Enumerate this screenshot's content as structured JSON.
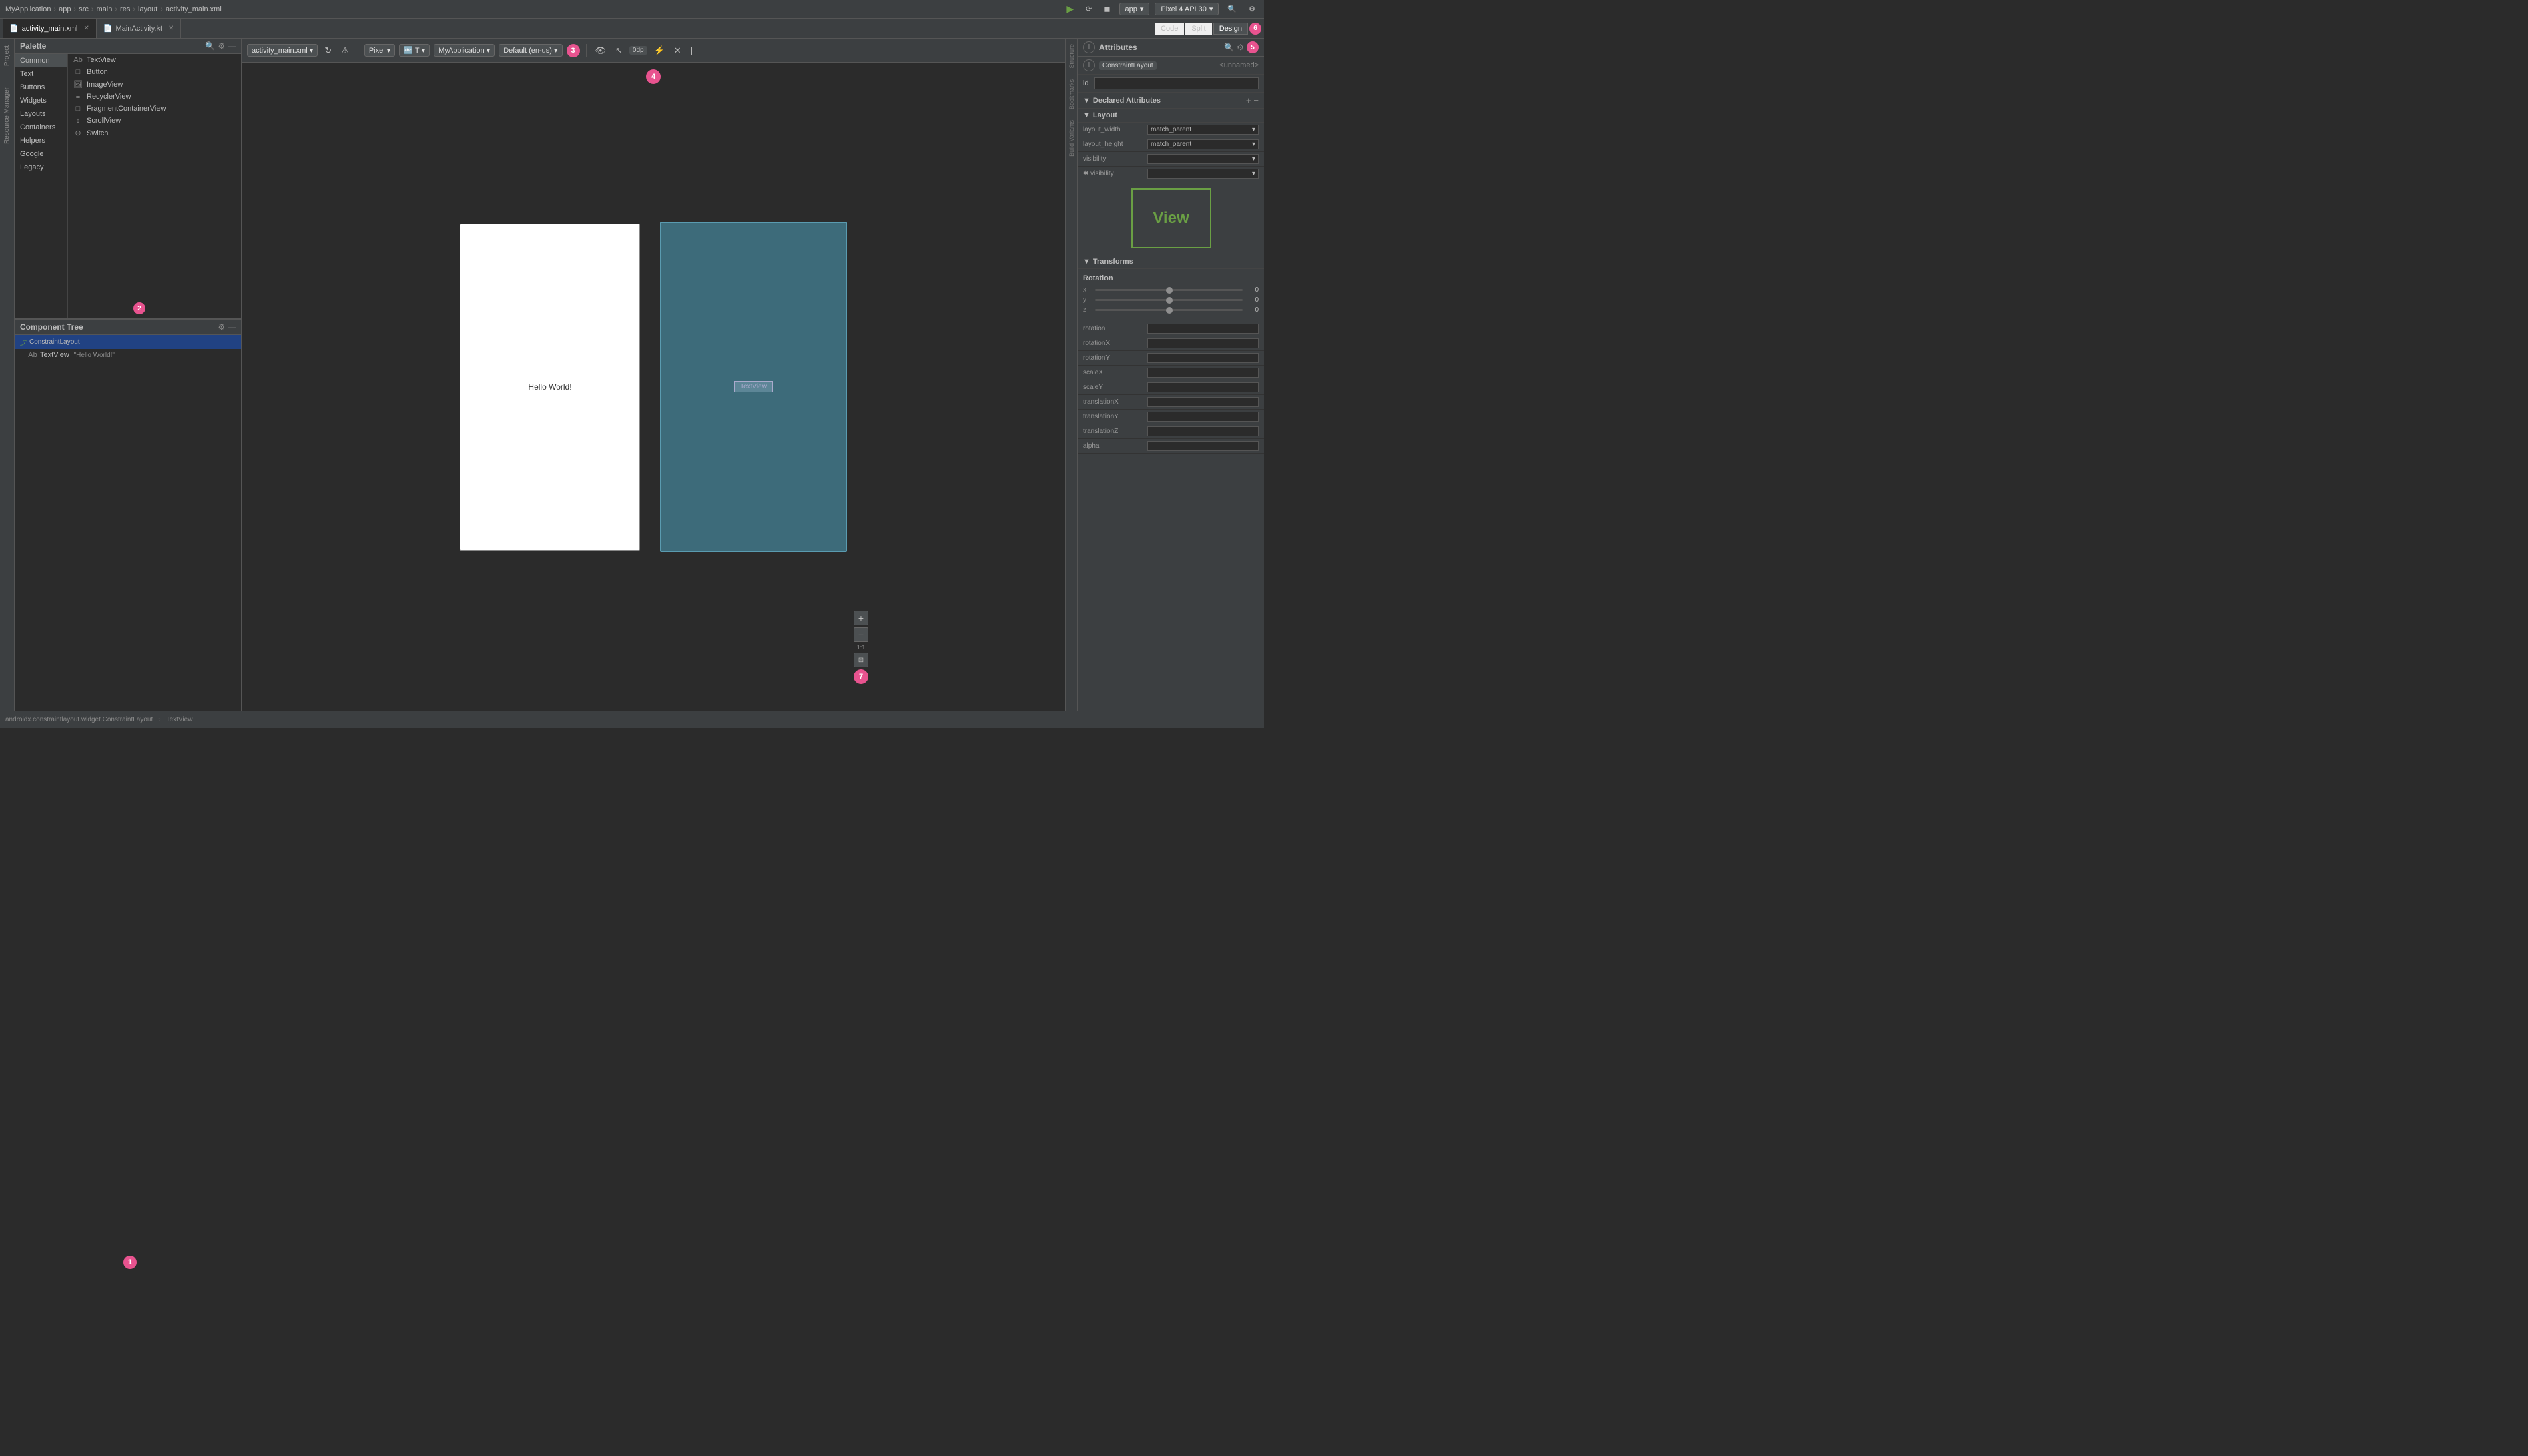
{
  "topbar": {
    "breadcrumb": [
      "MyApplication",
      "app",
      "src",
      "main",
      "res",
      "layout",
      "activity_main.xml"
    ],
    "app_label": "app",
    "device_label": "Pixel 4 API 30",
    "run_icon": "▶",
    "search_icon": "🔍",
    "gear_icon": "⚙"
  },
  "tabs": [
    {
      "id": "activity_main",
      "label": "activity_main.xml",
      "icon": "📄",
      "active": true
    },
    {
      "id": "main_activity",
      "label": "MainActivity.kt",
      "icon": "📄",
      "active": false
    }
  ],
  "view_buttons": [
    "Code",
    "Split",
    "Design"
  ],
  "active_view": "Design",
  "palette": {
    "title": "Palette",
    "categories": [
      "Common",
      "Text",
      "Buttons",
      "Widgets",
      "Layouts",
      "Containers",
      "Helpers",
      "Google",
      "Legacy"
    ],
    "active_category": "Common",
    "items": [
      {
        "label": "TextView",
        "icon": "Ab"
      },
      {
        "label": "Button",
        "icon": "□"
      },
      {
        "label": "ImageView",
        "icon": "🖼"
      },
      {
        "label": "RecyclerView",
        "icon": "≡"
      },
      {
        "label": "FragmentContainerView",
        "icon": "□"
      },
      {
        "label": "ScrollView",
        "icon": "↕"
      },
      {
        "label": "Switch",
        "icon": "⊙"
      }
    ]
  },
  "component_tree": {
    "title": "Component Tree",
    "items": [
      {
        "label": "ConstraintLayout",
        "icon": "⤴",
        "level": 0,
        "selected": false
      },
      {
        "label": "TextView",
        "icon": "Ab",
        "level": 1,
        "selected": true,
        "extra": "\"Hello World!\""
      }
    ]
  },
  "design_toolbar": {
    "file_dropdown": "activity_main.xml",
    "pixel_dropdown": "Pixel",
    "t_dropdown": "T",
    "app_dropdown": "MyApplication",
    "locale_dropdown": "Default (en-us)",
    "dp_label": "0dp",
    "badge3": "3"
  },
  "canvas": {
    "hello_world": "Hello World!",
    "textview_label": "TextView",
    "badge4": "4",
    "badge7": "7"
  },
  "attributes": {
    "title": "Attributes",
    "component": "ConstraintLayout",
    "component_detail": "<unnamed>",
    "badge5": "5",
    "id_label": "id",
    "id_value": "",
    "declared_attributes_label": "Declared Attributes",
    "layout_section": "Layout",
    "transforms_section": "Transforms",
    "layout_rows": [
      {
        "label": "layout_width",
        "value": "match_parent"
      },
      {
        "label": "layout_height",
        "value": "match_parent"
      },
      {
        "label": "visibility",
        "value": ""
      },
      {
        "label": "✱ visibility",
        "value": ""
      }
    ],
    "view_preview_text": "View",
    "rotation_label": "Rotation",
    "rotation_axes": [
      {
        "axis": "x",
        "value": "0"
      },
      {
        "axis": "y",
        "value": "0"
      },
      {
        "axis": "z",
        "value": "0"
      }
    ],
    "transform_rows": [
      {
        "label": "rotation",
        "value": ""
      },
      {
        "label": "rotationX",
        "value": ""
      },
      {
        "label": "rotationY",
        "value": ""
      },
      {
        "label": "scaleX",
        "value": ""
      },
      {
        "label": "scaleY",
        "value": ""
      },
      {
        "label": "translationX",
        "value": ""
      },
      {
        "label": "translationY",
        "value": ""
      },
      {
        "label": "translationZ",
        "value": ""
      },
      {
        "label": "alpha",
        "value": ""
      }
    ]
  },
  "status_bar": {
    "class_path": "androidx.constraintlayout.widget.ConstraintLayout",
    "element": "TextView"
  },
  "side_labels": [
    "Project",
    "Resource Manager",
    "Structure",
    "Bookmarks",
    "Build Variants"
  ],
  "badges": {
    "b1": "1",
    "b2": "2",
    "b3": "3",
    "b4": "4",
    "b5": "5",
    "b6": "6",
    "b7": "7"
  }
}
